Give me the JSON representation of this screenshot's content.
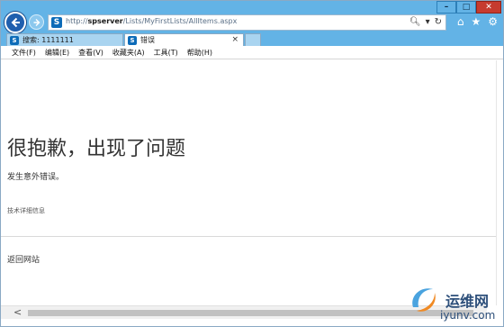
{
  "browser": {
    "address": {
      "url_prefix": "http://",
      "url_host": "spserver",
      "url_path": "/Lists/MyFirstLists/AllItems.aspx"
    },
    "address_tools": {
      "search_glyph": "🔍︎",
      "dropdown_glyph": "▾",
      "refresh_glyph": "↻"
    },
    "tabs": [
      {
        "label": "搜索: 1111111",
        "active": false
      },
      {
        "label": "错误",
        "active": true,
        "close": "×"
      }
    ],
    "window_controls": {
      "minimize": "–",
      "maximize": "□",
      "close": "✕"
    },
    "right_tools": {
      "home": "⌂",
      "favorites": "★",
      "settings": "⚙"
    }
  },
  "menu": {
    "items": [
      "文件(F)",
      "编辑(E)",
      "查看(V)",
      "收藏夹(A)",
      "工具(T)",
      "帮助(H)"
    ]
  },
  "page": {
    "error_title": "很抱歉，出现了问题",
    "error_description": "发生意外错误。",
    "technical_details": "技术详细信息",
    "go_back": "返回网站"
  },
  "scrollbar": {
    "left_arrow": "<"
  },
  "watermark": {
    "cn": "运维网",
    "en": "iyunv.com"
  },
  "colors": {
    "titlebar": "#63b3e6",
    "sharepoint_blue": "#0d6bb8",
    "back_button": "#1f5fae",
    "close_button": "#c63b2f"
  }
}
